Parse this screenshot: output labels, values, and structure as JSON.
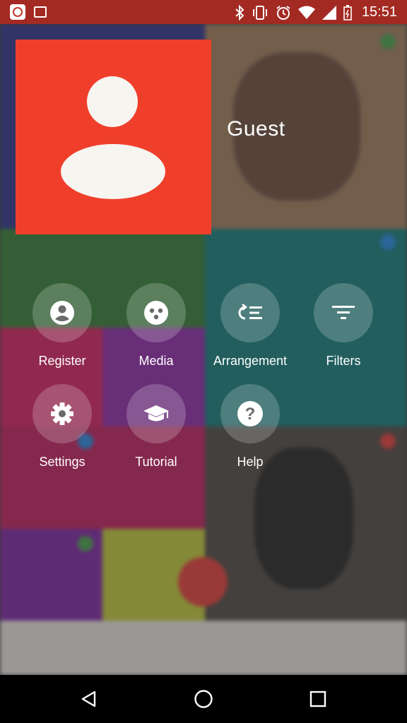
{
  "status_bar": {
    "time": "15:51",
    "icons": [
      "app-icon",
      "gallery-icon",
      "bluetooth-icon",
      "vibrate-icon",
      "alarm-icon",
      "wifi-icon",
      "signal-icon",
      "battery-icon"
    ]
  },
  "drawer": {
    "username": "Guest",
    "profile_color": "#ef3f2b",
    "menu": [
      {
        "label": "Register",
        "icon": "account-circle-icon"
      },
      {
        "label": "Media",
        "icon": "media-icon"
      },
      {
        "label": "Arrangement",
        "icon": "arrangement-icon"
      },
      {
        "label": "Filters",
        "icon": "filter-icon"
      },
      {
        "label": "Settings",
        "icon": "gear-icon"
      },
      {
        "label": "Tutorial",
        "icon": "graduation-cap-icon"
      },
      {
        "label": "Help",
        "icon": "help-icon"
      }
    ]
  },
  "nav_bar": {
    "buttons": [
      "back-icon",
      "home-icon",
      "recents-icon"
    ]
  }
}
